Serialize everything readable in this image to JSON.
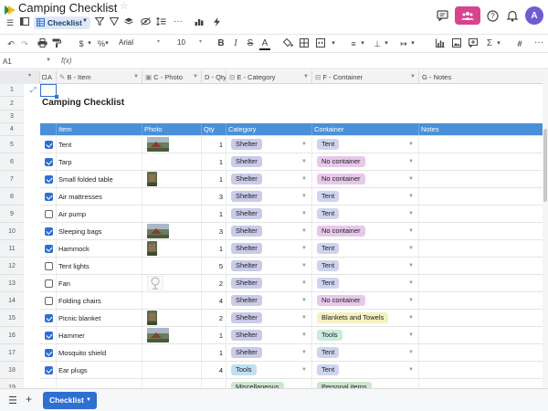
{
  "app": {
    "title": "Camping Checklist",
    "share_color": "#d8438f",
    "avatar_initial": "A",
    "avatar_color": "#6f5bd3",
    "accent": "#2f6fd1"
  },
  "viewbar": {
    "view_name": "Checklist",
    "icons": [
      "menu-icon",
      "sidebar-icon",
      "grid-view-icon",
      "filter-icon",
      "sort-icon",
      "layers-icon",
      "hide-icon",
      "row-height-icon",
      "more-icon",
      "chart-icon",
      "automation-icon"
    ]
  },
  "format": {
    "font": "Arial",
    "size": "10"
  },
  "formula": {
    "cell_ref": "A1",
    "fx_label": "f(x)"
  },
  "columns": {
    "a": "A",
    "b": "B - Item",
    "c": "C - Photo",
    "d": "D - Qty",
    "e": "E - Category",
    "f": "F - Container",
    "g": "G - Notes"
  },
  "row_numbers": [
    "1",
    "2",
    "3",
    "4",
    "5",
    "6",
    "7",
    "8",
    "9",
    "10",
    "11",
    "12",
    "13",
    "14",
    "15",
    "16",
    "17",
    "18",
    "19"
  ],
  "sheet_title": "Camping Checklist",
  "table_header": {
    "item": "Item",
    "photo": "Photo",
    "qty": "Qty",
    "category": "Category",
    "container": "Container",
    "notes": "Notes"
  },
  "chip_colors": {
    "Shelter": "#c9cbe8",
    "Tools": "#bfe0f2",
    "Tent": "#cfd4ee",
    "No container": "#e8c8ea",
    "Blankets and Towels": "#f4f0bf",
    "Tools_container": "#c8ecde",
    "Miscellaneous": "#cde7cf"
  },
  "rows": [
    {
      "checked": true,
      "item": "Tent",
      "photo": "landscape",
      "qty": "1",
      "category": "Shelter",
      "container": "Tent"
    },
    {
      "checked": true,
      "item": "Tarp",
      "photo": "",
      "qty": "1",
      "category": "Shelter",
      "container": "No container"
    },
    {
      "checked": true,
      "item": "Small folded table",
      "photo": "portrait",
      "qty": "1",
      "category": "Shelter",
      "container": "No container"
    },
    {
      "checked": true,
      "item": "Air mattresses",
      "photo": "",
      "qty": "3",
      "category": "Shelter",
      "container": "Tent"
    },
    {
      "checked": false,
      "item": "Air pump",
      "photo": "",
      "qty": "1",
      "category": "Shelter",
      "container": "Tent"
    },
    {
      "checked": true,
      "item": "Sleeping bags",
      "photo": "landscape",
      "qty": "3",
      "category": "Shelter",
      "container": "No container"
    },
    {
      "checked": true,
      "item": "Hammock",
      "photo": "portrait",
      "qty": "1",
      "category": "Shelter",
      "container": "Tent"
    },
    {
      "checked": false,
      "item": "Tent lights",
      "photo": "",
      "qty": "5",
      "category": "Shelter",
      "container": "Tent"
    },
    {
      "checked": false,
      "item": "Fan",
      "photo": "fan",
      "qty": "2",
      "category": "Shelter",
      "container": "Tent"
    },
    {
      "checked": false,
      "item": "Folding chairs",
      "photo": "",
      "qty": "4",
      "category": "Shelter",
      "container": "No container"
    },
    {
      "checked": true,
      "item": "Picnic blanket",
      "photo": "portrait",
      "qty": "2",
      "category": "Shelter",
      "container": "Blankets and Towels"
    },
    {
      "checked": true,
      "item": "Hammer",
      "photo": "landscape",
      "qty": "1",
      "category": "Shelter",
      "container": "Tools"
    },
    {
      "checked": true,
      "item": "Mosquito shield",
      "photo": "",
      "qty": "1",
      "category": "Shelter",
      "container": "Tent"
    },
    {
      "checked": true,
      "item": "Ear plugs",
      "photo": "",
      "qty": "4",
      "category": "Tools",
      "container": "Tent"
    }
  ],
  "partial_row": {
    "category": "Miscellaneous",
    "container": "Personal items"
  },
  "bottom": {
    "sheet_tab": "Checklist"
  }
}
